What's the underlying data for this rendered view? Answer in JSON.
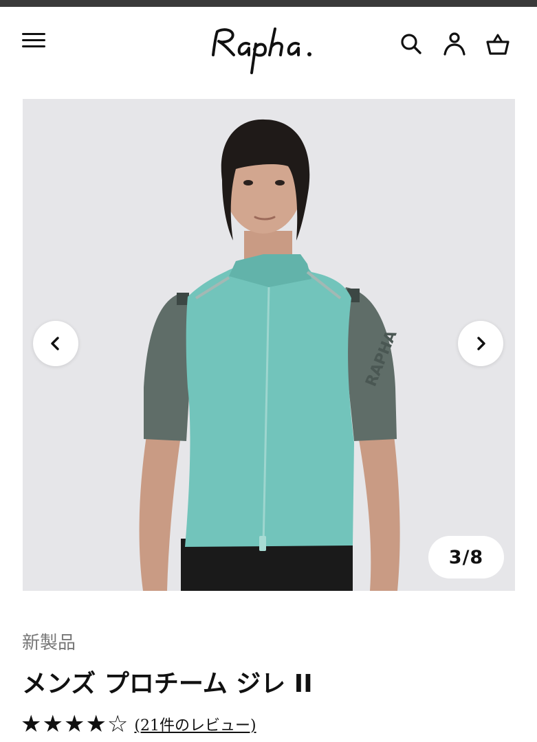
{
  "header": {
    "logo_text": "Rapha.",
    "menu_icon": "hamburger-menu-icon",
    "search_icon": "search-icon",
    "account_icon": "user-icon",
    "cart_icon": "basket-icon"
  },
  "gallery": {
    "counter": "3/8",
    "current_index": 3,
    "total": 8,
    "prev_icon": "chevron-left-icon",
    "next_icon": "chevron-right-icon"
  },
  "product": {
    "badge": "新製品",
    "title": "メンズ プロチーム ジレ II",
    "rating_stars": "★★★★☆",
    "rating_value": 4,
    "rating_max": 5,
    "reviews_label": "(21件のレビュー)"
  },
  "colors": {
    "topbar": "#3a3a3a",
    "gallery_bg": "#e6e6e9",
    "gilet": "#72c4bb",
    "jersey": "#5f6d68"
  }
}
